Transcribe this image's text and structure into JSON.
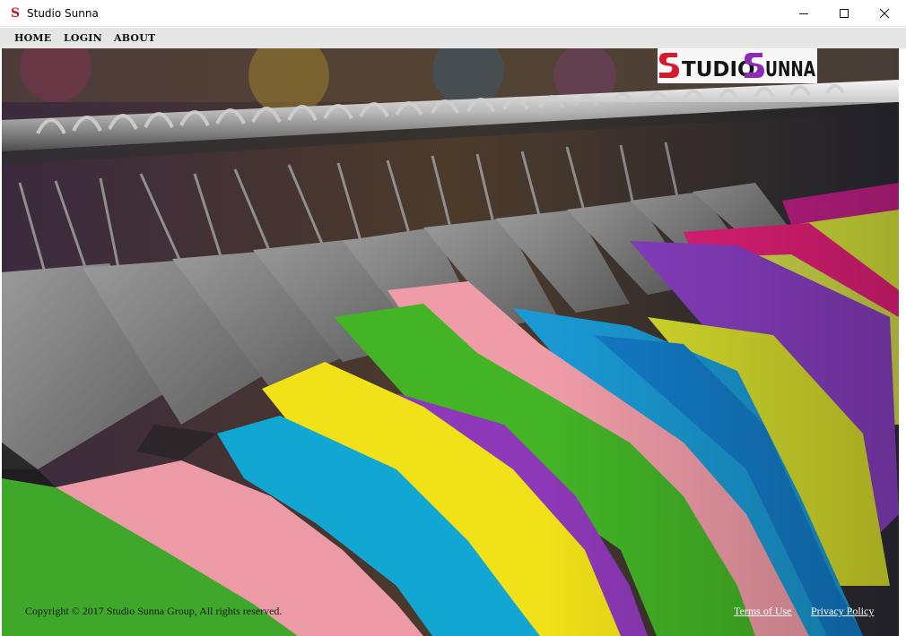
{
  "window": {
    "title": "Studio Sunna",
    "app_icon": "studio-sunna-s-logo",
    "controls": {
      "minimize_icon": "minimize-icon",
      "maximize_icon": "maximize-icon",
      "close_icon": "close-icon"
    }
  },
  "menu": {
    "items": [
      {
        "label": "HOME"
      },
      {
        "label": "LOGIN"
      },
      {
        "label": "ABOUT"
      }
    ]
  },
  "logo": {
    "text": "STUDIO SUNNA",
    "colors": {
      "first_s": "#d6192c",
      "second_s": "#8e2bb6",
      "letters": "#151515"
    }
  },
  "hero": {
    "description_icon": "clothing-rack-image"
  },
  "footer": {
    "copyright": "Copyright © 2017 Studio Sunna Group, All rights reserved.",
    "terms_label": "Terms of Use",
    "privacy_label": "Privacy Policy"
  }
}
